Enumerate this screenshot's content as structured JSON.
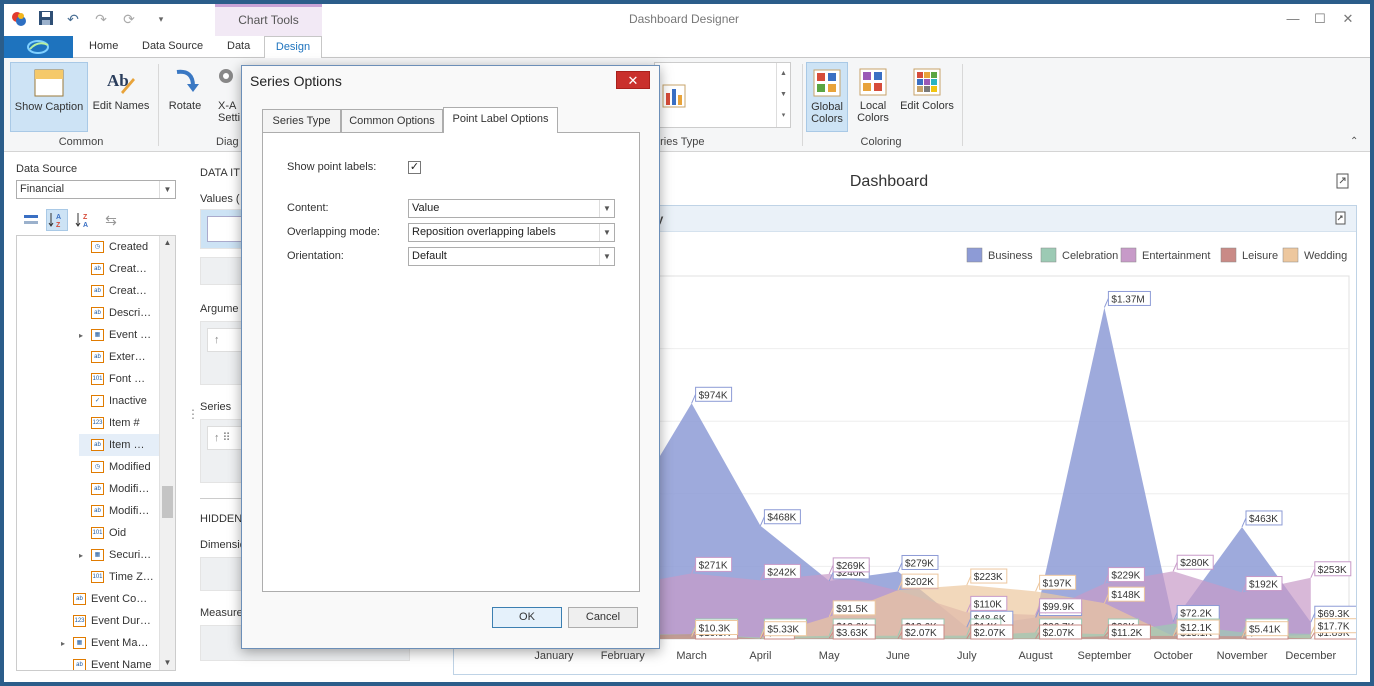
{
  "app": {
    "title": "Dashboard Designer",
    "context_tab": "Chart Tools"
  },
  "tabs": [
    "Home",
    "Data Source",
    "Data",
    "Design"
  ],
  "ribbon": {
    "common": {
      "show_caption": "Show Caption",
      "edit_names": "Edit Names",
      "group": "Common"
    },
    "diagram": {
      "rotate": "Rotate",
      "xaxis": "X-A",
      "xaxis2": "Setti",
      "group": "Diag"
    },
    "series_type_group": "eries Type",
    "coloring": {
      "global_colors": "Global",
      "global_colors2": "Colors",
      "local_colors": "Local",
      "local_colors2": "Colors",
      "edit_colors": "Edit Colors",
      "group": "Coloring"
    }
  },
  "data_source": {
    "label": "Data Source",
    "selected": "Financial",
    "items": [
      {
        "label": "Created",
        "type": "date",
        "expand": false,
        "indent": 1
      },
      {
        "label": "Creat…",
        "type": "ab",
        "expand": false,
        "indent": 1
      },
      {
        "label": "Creat…",
        "type": "ab",
        "expand": false,
        "indent": 1
      },
      {
        "label": "Descri…",
        "type": "ab",
        "expand": false,
        "indent": 1
      },
      {
        "label": "Event …",
        "type": "table",
        "expand": true,
        "indent": 1
      },
      {
        "label": "Exter…",
        "type": "ab",
        "expand": false,
        "indent": 1
      },
      {
        "label": "Font …",
        "type": "101",
        "expand": false,
        "indent": 1
      },
      {
        "label": "Inactive",
        "type": "check",
        "expand": false,
        "indent": 1
      },
      {
        "label": "Item #",
        "type": "123",
        "expand": false,
        "indent": 1
      },
      {
        "label": "Item …",
        "type": "ab",
        "expand": false,
        "indent": 1
      },
      {
        "label": "Modified",
        "type": "date",
        "expand": false,
        "indent": 1
      },
      {
        "label": "Modifi…",
        "type": "ab",
        "expand": false,
        "indent": 1
      },
      {
        "label": "Modifi…",
        "type": "ab",
        "expand": false,
        "indent": 1
      },
      {
        "label": "Oid",
        "type": "101",
        "expand": false,
        "indent": 1
      },
      {
        "label": "Securi…",
        "type": "table",
        "expand": true,
        "indent": 1
      },
      {
        "label": "Time Z…",
        "type": "101",
        "expand": false,
        "indent": 1
      },
      {
        "label": "Event Co…",
        "type": "ab",
        "expand": false,
        "indent": 0
      },
      {
        "label": "Event Dur…",
        "type": "123",
        "expand": false,
        "indent": 0
      },
      {
        "label": "Event Ma…",
        "type": "table",
        "expand": true,
        "indent": 0
      },
      {
        "label": "Event Name",
        "type": "ab",
        "expand": false,
        "indent": 0
      }
    ]
  },
  "data_items": {
    "header": "DATA IT",
    "values": "Values (",
    "argument": "Argume",
    "series": "Series",
    "hidden": "HIDDEN",
    "dimensions": "Dimensio",
    "measures": "Measure"
  },
  "dashboard": {
    "title": "Dashboard",
    "caption_fragment": "ry"
  },
  "chart_data": {
    "type": "area",
    "categories": [
      "January",
      "February",
      "March",
      "April",
      "May",
      "June",
      "July",
      "August",
      "September",
      "October",
      "November",
      "December"
    ],
    "legend": [
      "Business",
      "Celebration",
      "Entertainment",
      "Leisure",
      "Wedding"
    ],
    "legend_position": "top-right",
    "colors": [
      "#8d9bd6",
      "#9ccab4",
      "#c79ac8",
      "#c98a86",
      "#edc79e"
    ],
    "series": [
      {
        "name": "Business",
        "values": [
          520000,
          500000,
          974000,
          468000,
          240000,
          279000,
          48600,
          88900,
          1370000,
          72200,
          463000,
          69300
        ],
        "labels": [
          "$",
          "$",
          "$974K",
          "$468K",
          "$240K",
          "$279K",
          "$48.6K",
          "$88.9K",
          "$1.37M",
          "$72.2K",
          "$463K",
          "$69.3K"
        ]
      },
      {
        "name": "Celebration",
        "values": [
          40000,
          20000,
          20400,
          6320,
          13600,
          13600,
          14000,
          26700,
          20000,
          62800,
          27200,
          21200
        ],
        "labels": [
          "",
          "K",
          "$20.4K",
          "$6.32K",
          "$13.6K",
          "$13.6K",
          "$14K",
          "$26.7K",
          "$20K",
          "$62.8K",
          "$27.2K",
          "$21.2K"
        ]
      },
      {
        "name": "Entertainment",
        "values": [
          200000,
          220000,
          271000,
          242000,
          269000,
          200000,
          110000,
          99900,
          229000,
          280000,
          192000,
          253000
        ],
        "labels": [
          "",
          "$",
          "$271K",
          "$242K",
          "$269K",
          "$200K",
          "$110K",
          "$99.9K",
          "$229K",
          "$280K",
          "$192K",
          "$253K"
        ]
      },
      {
        "name": "Leisure",
        "values": [
          10000,
          15000,
          19900,
          944,
          3630,
          2070,
          2070,
          2070,
          11200,
          13100,
          11300,
          1890
        ],
        "labels": [
          "",
          "",
          "$19.9K",
          "$944",
          "$3.63K",
          "$2.07K",
          "$2.07K",
          "$2.07K",
          "$11.2K",
          "$13.1K",
          "$11.3K",
          "$1.89K"
        ]
      },
      {
        "name": "Wedding",
        "values": [
          20000,
          25000,
          10300,
          5330,
          91500,
          202000,
          223000,
          197000,
          148000,
          12100,
          5410,
          17700
        ],
        "labels": [
          "",
          "K",
          "$10.3K",
          "$5.33K",
          "$91.5K",
          "$202K",
          "$223K",
          "$197K",
          "$148K",
          "$12.1K",
          "$5.41K",
          "$17.7K"
        ]
      }
    ],
    "ylim": [
      0,
      1500000
    ],
    "grid": true
  },
  "dialog": {
    "title": "Series Options",
    "close": "✕",
    "tabs": [
      "Series Type",
      "Common Options",
      "Point Label Options"
    ],
    "active_tab": "Point Label Options",
    "show_point_labels_label": "Show point labels:",
    "show_point_labels_checked": "✓",
    "content_label": "Content:",
    "content_value": "Value",
    "overlap_label": "Overlapping mode:",
    "overlap_value": "Reposition overlapping labels",
    "orientation_label": "Orientation:",
    "orientation_value": "Default",
    "ok": "OK",
    "cancel": "Cancel"
  }
}
